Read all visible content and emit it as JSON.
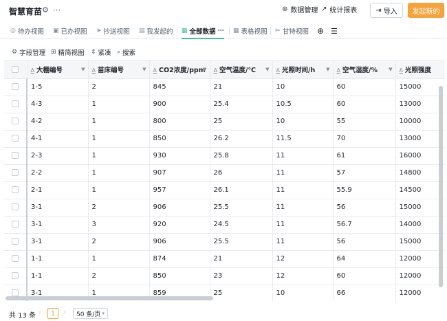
{
  "header": {
    "title": "智慧育苗",
    "data_manage": "数据管理",
    "stats_report": "统计报表",
    "import": "导入",
    "launch": "发起新的"
  },
  "tabs": [
    {
      "label": "待办视图",
      "icon": "check-circle-icon"
    },
    {
      "label": "已办视图",
      "icon": "done-box-icon"
    },
    {
      "label": "抄送视图",
      "icon": "send-icon"
    },
    {
      "label": "我发起的",
      "icon": "document-icon"
    },
    {
      "label": "全部数据",
      "icon": "table-icon"
    },
    {
      "label": "表格视图",
      "icon": "table-icon"
    },
    {
      "label": "甘特视图",
      "icon": "gantt-icon"
    }
  ],
  "toolbar": {
    "field_manage": "字段管理",
    "simple_view": "精简视图",
    "compact": "紧凑",
    "search": "搜索"
  },
  "table": {
    "columns": [
      "大棚编号",
      "苗床编号",
      "CO2浓度/ppm",
      "空气温度/℃",
      "光照时间/h",
      "空气湿度/%",
      "光照强度"
    ],
    "rows": [
      [
        "1-5",
        "2",
        "845",
        "21",
        "10",
        "60",
        "15000"
      ],
      [
        "4-3",
        "1",
        "900",
        "25.4",
        "10.5",
        "60",
        "13000"
      ],
      [
        "4-2",
        "1",
        "800",
        "25",
        "10",
        "55",
        "10000"
      ],
      [
        "4-1",
        "1",
        "850",
        "26.2",
        "11.5",
        "70",
        "13000"
      ],
      [
        "2-3",
        "1",
        "930",
        "25.8",
        "11",
        "61",
        "16000"
      ],
      [
        "2-2",
        "1",
        "907",
        "26",
        "11",
        "57",
        "14800"
      ],
      [
        "2-1",
        "1",
        "957",
        "26.1",
        "11",
        "55.9",
        "14500"
      ],
      [
        "3-1",
        "2",
        "906",
        "25.5",
        "11",
        "56",
        "15000"
      ],
      [
        "3-1",
        "3",
        "920",
        "24.5",
        "11",
        "56.7",
        "14000"
      ],
      [
        "3-1",
        "2",
        "906",
        "25.5",
        "11",
        "56",
        "15000"
      ],
      [
        "1-1",
        "1",
        "874",
        "21",
        "12",
        "64",
        "12000"
      ],
      [
        "1-1",
        "2",
        "850",
        "23",
        "12",
        "60",
        "12000"
      ],
      [
        "3-1",
        "1",
        "859",
        "25",
        "10",
        "66",
        "12000"
      ]
    ]
  },
  "footer": {
    "total": "共 13 条",
    "page": "1",
    "page_size": "50 条/页"
  }
}
